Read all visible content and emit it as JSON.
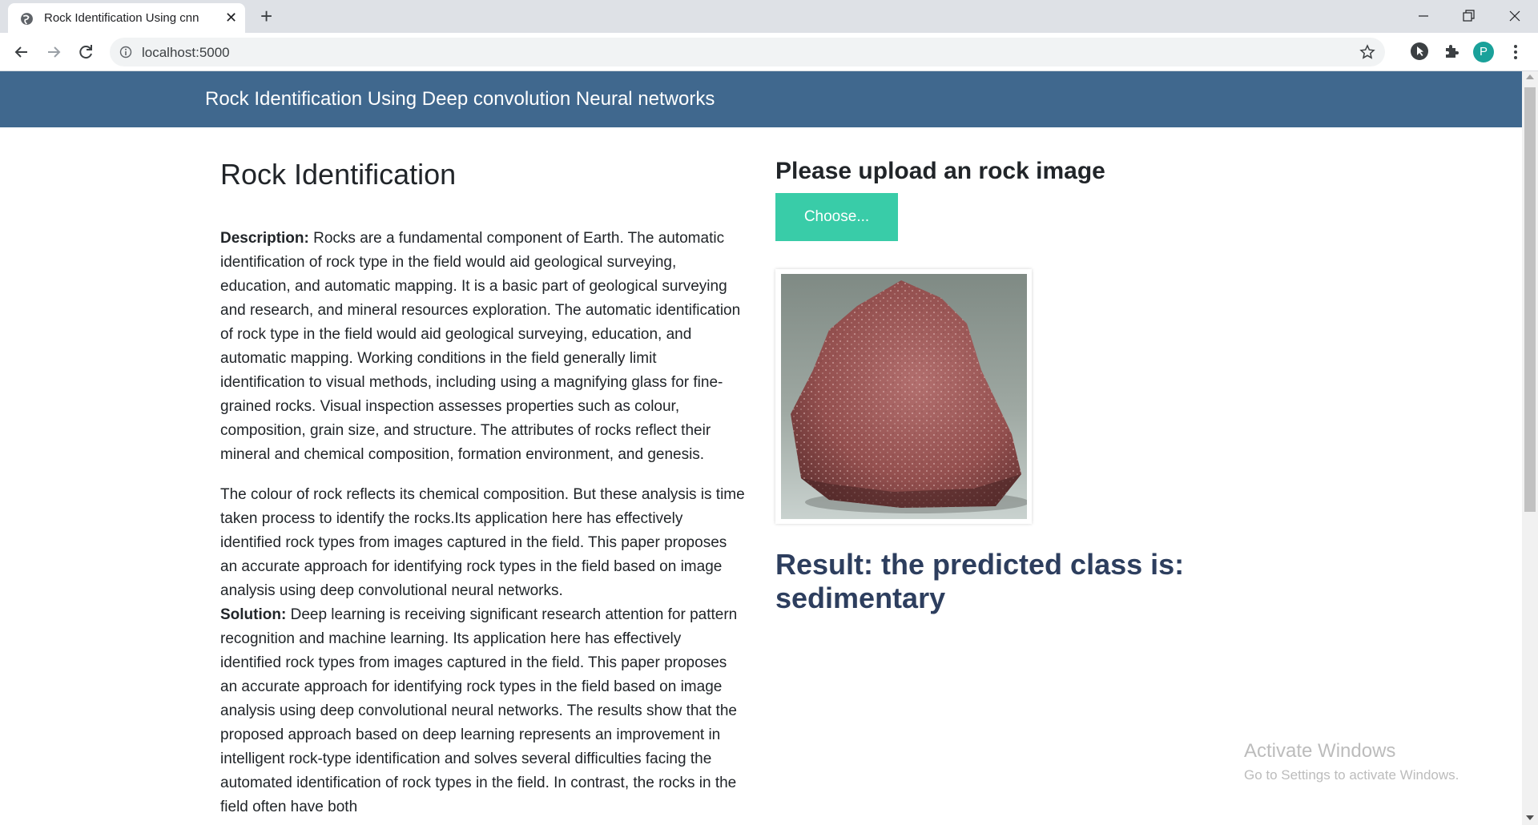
{
  "browser": {
    "tab_title": "Rock Identification Using cnn",
    "url": "localhost:5000",
    "profile_initial": "P"
  },
  "navbar": {
    "title": "Rock Identification Using Deep convolution Neural networks"
  },
  "left": {
    "heading": "Rock Identification",
    "description_label": "Description:",
    "description_text": " Rocks are a fundamental component of Earth. The automatic identification of rock type in the field would aid geological surveying, education, and automatic mapping. It is a basic part of geological surveying and research, and mineral resources exploration. The automatic identification of rock type in the field would aid geological surveying, education, and automatic mapping. Working conditions in the field generally limit identification to visual methods, including using a magnifying glass for fine-grained rocks. Visual inspection assesses properties such as colour, composition, grain size, and structure. The attributes of rocks reflect their mineral and chemical composition, formation environment, and genesis.",
    "paragraph2": "The colour of rock reflects its chemical composition. But these analysis is time taken process to identify the rocks.Its application here has effectively identified rock types from images captured in the field. This paper proposes an accurate approach for identifying rock types in the field based on image analysis using deep convolutional neural networks.",
    "solution_label": "Solution:",
    "solution_text": " Deep learning is receiving significant research attention for pattern recognition and machine learning. Its application here has effectively identified rock types from images captured in the field. This paper proposes an accurate approach for identifying rock types in the field based on image analysis using deep convolutional neural networks. The results show that the proposed approach based on deep learning represents an improvement in intelligent rock-type identification and solves several difficulties facing the automated identification of rock types in the field. In contrast, the rocks in the field often have both"
  },
  "right": {
    "upload_heading": "Please upload an rock image",
    "choose_label": "Choose...",
    "result_text": "Result: the predicted class is: sedimentary"
  },
  "watermark": {
    "line1": "Activate Windows",
    "line2": "Go to Settings to activate Windows."
  },
  "colors": {
    "navbar": "#40688e",
    "button": "#39cca8",
    "result": "#2d3e5e"
  }
}
